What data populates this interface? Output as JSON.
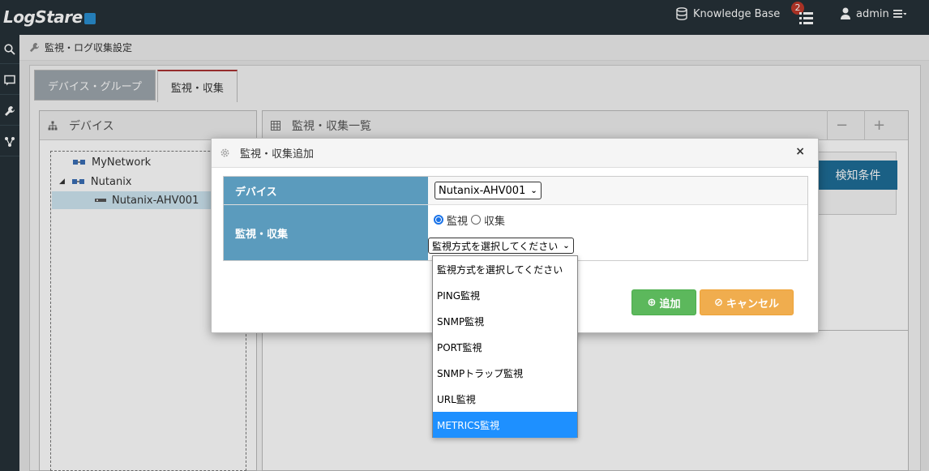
{
  "app": {
    "logo_text": "LogStare",
    "knowledge_base": "Knowledge Base",
    "notification_count": "2",
    "user": "admin"
  },
  "breadcrumb": "監視・ログ収集設定",
  "tabs": [
    {
      "label": "デバイス・グループ",
      "active": false
    },
    {
      "label": "監視・収集",
      "active": true
    }
  ],
  "left_panel": {
    "title": "デバイス",
    "tree": [
      {
        "label": "MyNetwork",
        "level": 1,
        "selected": false
      },
      {
        "label": "Nutanix",
        "level": 1,
        "expanded": true,
        "selected": false
      },
      {
        "label": "Nutanix-AHV001",
        "level": 2,
        "selected": true
      }
    ]
  },
  "right_panel": {
    "title": "監視・収集一覧",
    "minus": "−",
    "plus": "+",
    "detect_label": "検知条件"
  },
  "modal": {
    "title": "監視・収集追加",
    "close": "×",
    "rows": {
      "device_label": "デバイス",
      "device_value": "Nutanix-AHV001",
      "type_label": "監視・収集",
      "radio_monitor": "監視",
      "radio_collect": "収集",
      "radio_selected": "監視",
      "method_placeholder": "監視方式を選択してください"
    },
    "add_button": "追加",
    "cancel_button": "キャンセル"
  },
  "dropdown": {
    "options": [
      "監視方式を選択してください",
      "PING監視",
      "SNMP監視",
      "PORT監視",
      "SNMPトラップ監視",
      "URL監視",
      "METRICS監視"
    ],
    "highlighted": "METRICS監視"
  },
  "colors": {
    "topbar": "#263238",
    "form_label": "#5b9bbd",
    "detect_button": "#1e6e98",
    "add_button": "#5cb85c",
    "cancel_button": "#f0ad4e",
    "highlight": "#1e90ff"
  }
}
